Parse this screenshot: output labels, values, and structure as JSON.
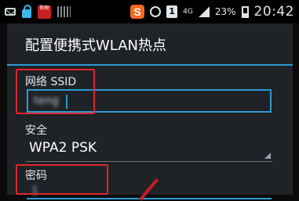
{
  "status_bar": {
    "app_icon_text": "购物",
    "sogou_icon": "S",
    "notification_number": "1",
    "network": "4G",
    "battery_percent": "23%",
    "time": "20:42",
    "icons": [
      "mail-icon",
      "lock-icon",
      "shopping-app-icon",
      "grid-icon",
      "sogou-icon",
      "alarm-icon",
      "notification-icon",
      "signal-icon",
      "battery-icon"
    ]
  },
  "dialog": {
    "title": "配置便携式WLAN热点",
    "ssid_label": "网络 SSID",
    "ssid_value": "teng",
    "security_label": "安全",
    "security_value": "WPA2 PSK",
    "password_label": "密码",
    "password_value": "1"
  },
  "colors": {
    "accent": "#2b9bd3",
    "annotation": "#e0262b",
    "dialog_bg": "#1f2227"
  }
}
